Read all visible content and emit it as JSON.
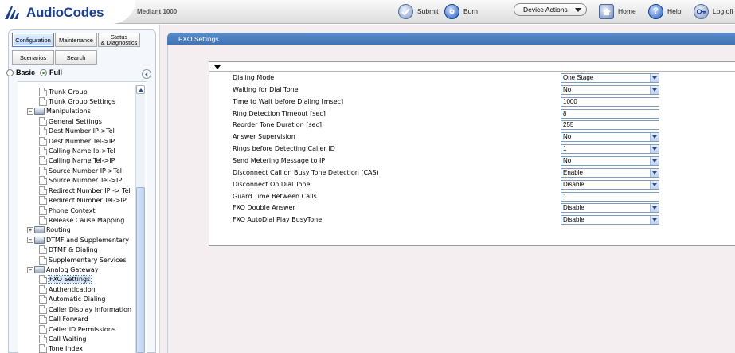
{
  "header": {
    "brand": "AudioCodes",
    "product": "Mediant 1000",
    "submit_label": "Submit",
    "burn_label": "Burn",
    "device_actions_label": "Device Actions",
    "home_label": "Home",
    "help_label": "Help",
    "logoff_label": "Log off",
    "brand_color": "#1d3f8f"
  },
  "nav": {
    "tabs": {
      "configuration": "Configuration",
      "maintenance": "Maintenance",
      "status_line1": "Status",
      "status_line2": "& Diagnostics",
      "scenarios": "Scenarios",
      "search": "Search"
    },
    "mode": {
      "basic": "Basic",
      "full": "Full",
      "selected": "Full"
    },
    "tree": [
      {
        "label": "Trunk Group",
        "kind": "page",
        "level": 2
      },
      {
        "label": "Trunk Group Settings",
        "kind": "page",
        "level": 2
      },
      {
        "label": "Manipulations",
        "kind": "folder",
        "level": 1,
        "expanded": true
      },
      {
        "label": "General Settings",
        "kind": "page",
        "level": 2
      },
      {
        "label": "Dest Number IP->Tel",
        "kind": "page",
        "level": 2
      },
      {
        "label": "Dest Number Tel->IP",
        "kind": "page",
        "level": 2
      },
      {
        "label": "Calling Name Ip->Tel",
        "kind": "page",
        "level": 2
      },
      {
        "label": "Calling Name Tel->IP",
        "kind": "page",
        "level": 2
      },
      {
        "label": "Source Number IP->Tel",
        "kind": "page",
        "level": 2
      },
      {
        "label": "Source Number Tel->IP",
        "kind": "page",
        "level": 2
      },
      {
        "label": "Redirect Number IP -> Tel",
        "kind": "page",
        "level": 2
      },
      {
        "label": "Redirect Number Tel->IP",
        "kind": "page",
        "level": 2
      },
      {
        "label": "Phone Context",
        "kind": "page",
        "level": 2
      },
      {
        "label": "Release Cause Mapping",
        "kind": "page",
        "level": 2
      },
      {
        "label": "Routing",
        "kind": "folder",
        "level": 1,
        "expanded": false
      },
      {
        "label": "DTMF and Supplementary",
        "kind": "folder",
        "level": 1,
        "expanded": true
      },
      {
        "label": "DTMF & Dialing",
        "kind": "page",
        "level": 2
      },
      {
        "label": "Supplementary Services",
        "kind": "page",
        "level": 2
      },
      {
        "label": "Analog Gateway",
        "kind": "folder",
        "level": 1,
        "expanded": true
      },
      {
        "label": "FXO Settings",
        "kind": "page",
        "level": 2,
        "selected": true
      },
      {
        "label": "Authentication",
        "kind": "page",
        "level": 2
      },
      {
        "label": "Automatic Dialing",
        "kind": "page",
        "level": 2
      },
      {
        "label": "Caller Display Information",
        "kind": "page",
        "level": 2
      },
      {
        "label": "Call Forward",
        "kind": "page",
        "level": 2
      },
      {
        "label": "Caller ID Permissions",
        "kind": "page",
        "level": 2
      },
      {
        "label": "Call Waiting",
        "kind": "page",
        "level": 2
      },
      {
        "label": "Tone Index",
        "kind": "page",
        "level": 2
      }
    ]
  },
  "main": {
    "title": "FXO Settings",
    "title_bar_color": "#4a7fc0",
    "settings": [
      {
        "label": "Dialing Mode",
        "value": "One Stage",
        "type": "select"
      },
      {
        "label": "Waiting for Dial Tone",
        "value": "No",
        "type": "select"
      },
      {
        "label": "Time to Wait before Dialing [msec]",
        "value": "1000",
        "type": "text"
      },
      {
        "label": "Ring Detection Timeout [sec]",
        "value": "8",
        "type": "text"
      },
      {
        "label": "Reorder Tone Duration [sec]",
        "value": "255",
        "type": "text"
      },
      {
        "label": "Answer Supervision",
        "value": "No",
        "type": "select"
      },
      {
        "label": "Rings before Detecting Caller ID",
        "value": "1",
        "type": "select"
      },
      {
        "label": "Send Metering Message to IP",
        "value": "No",
        "type": "select"
      },
      {
        "label": "Disconnect Call on Busy Tone Detection (CAS)",
        "value": "Enable",
        "type": "select"
      },
      {
        "label": "Disconnect On Dial Tone",
        "value": "Disable",
        "type": "select"
      },
      {
        "label": "Guard Time Between Calls",
        "value": "1",
        "type": "text"
      },
      {
        "label": "FXO Double Answer",
        "value": "Disable",
        "type": "select"
      },
      {
        "label": "FXO AutoDial Play BusyTone",
        "value": "Disable",
        "type": "select"
      }
    ]
  }
}
